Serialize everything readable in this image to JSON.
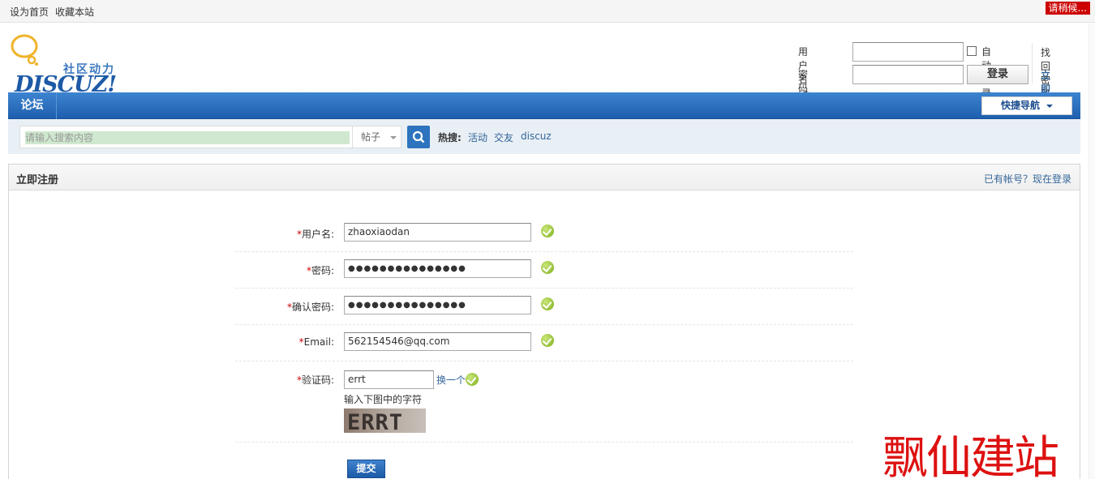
{
  "topbar": {
    "set_home": "设为首页",
    "bookmark": "收藏本站",
    "loading": "请稍候..."
  },
  "logo": {
    "cn": "社区动力",
    "en": "DISCUZ!"
  },
  "login": {
    "username_label": "用户名",
    "password_label": "密码",
    "auto_login": "自动登录",
    "login_button": "登录",
    "find_password": "找回密码",
    "register_now": "立即注册",
    "username_value": "",
    "password_value": ""
  },
  "nav": {
    "forum": "论坛",
    "quick_nav": "快捷导航"
  },
  "search": {
    "placeholder": "请输入搜索内容",
    "type": "帖子",
    "hot_label": "热搜:",
    "hot_items": [
      "活动",
      "交友",
      "discuz"
    ]
  },
  "register": {
    "title": "立即注册",
    "have_account": "已有帐号？现在登录",
    "required_mark": "*",
    "username_label": "用户名:",
    "username_value": "zhaoxiaodan",
    "password_label": "密码:",
    "password_value": "●●●●●●●●●●●●●●●",
    "confirm_label": "确认密码:",
    "confirm_value": "●●●●●●●●●●●●●●●",
    "email_label": "Email:",
    "email_value": "562154546@qq.com",
    "captcha_label": "验证码:",
    "captcha_value": "errt",
    "captcha_refresh": "换一个",
    "captcha_hint": "输入下图中的字符",
    "captcha_image_text": "ERRT",
    "submit": "提交"
  },
  "watermark": "飘仙建站",
  "colors": {
    "nav_blue": "#2e73bd",
    "link_blue": "#336699",
    "required_red": "#cc0000",
    "ok_green": "#7fae1b",
    "loading_red": "#cc0000",
    "watermark_red": "#dd1111"
  }
}
